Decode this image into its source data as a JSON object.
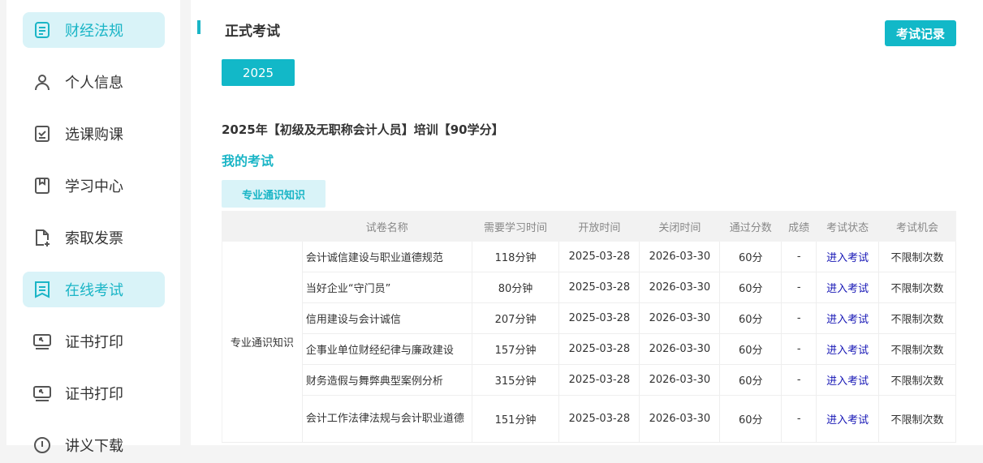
{
  "sidebar": {
    "items": [
      {
        "label": "财经法规",
        "icon": "document-icon",
        "active": true
      },
      {
        "label": "个人信息",
        "icon": "user-icon"
      },
      {
        "label": "选课购课",
        "icon": "checkbox-icon"
      },
      {
        "label": "学习中心",
        "icon": "bookmark-icon"
      },
      {
        "label": "索取发票",
        "icon": "file-add-icon"
      },
      {
        "label": "在线考试",
        "icon": "exam-icon",
        "active": true
      },
      {
        "label": "证书打印",
        "icon": "monitor-icon"
      },
      {
        "label": "证书打印",
        "icon": "monitor-icon"
      },
      {
        "label": "讲义下载",
        "icon": "download-icon"
      }
    ]
  },
  "main": {
    "title": "正式考试",
    "record_button": "考试记录",
    "year": "2025",
    "course_title": "2025年【初级及无职称会计人员】培训【90学分】",
    "my_exams": "我的考试",
    "tab": "专业通识知识",
    "columns": [
      "",
      "试卷名称",
      "需要学习时间",
      "开放时间",
      "关闭时间",
      "通过分数",
      "成绩",
      "考试状态",
      "考试机会"
    ],
    "category": "专业通识知识",
    "rows": [
      [
        "会计诚信建设与职业道德规范",
        "118分钟",
        "2025-03-28",
        "2026-03-30",
        "60分",
        "-",
        "进入考试",
        "不限制次数"
      ],
      [
        "当好企业“守门员”",
        "80分钟",
        "2025-03-28",
        "2026-03-30",
        "60分",
        "-",
        "进入考试",
        "不限制次数"
      ],
      [
        "信用建设与会计诚信",
        "207分钟",
        "2025-03-28",
        "2026-03-30",
        "60分",
        "-",
        "进入考试",
        "不限制次数"
      ],
      [
        "企事业单位财经纪律与廉政建设",
        "157分钟",
        "2025-03-28",
        "2026-03-30",
        "60分",
        "-",
        "进入考试",
        "不限制次数"
      ],
      [
        "财务造假与舞弊典型案例分析",
        "315分钟",
        "2025-03-28",
        "2026-03-30",
        "60分",
        "-",
        "进入考试",
        "不限制次数"
      ],
      [
        "会计工作法律法规与会计职业道德",
        "151分钟",
        "2025-03-28",
        "2026-03-30",
        "60分",
        "-",
        "进入考试",
        "不限制次数"
      ]
    ]
  }
}
